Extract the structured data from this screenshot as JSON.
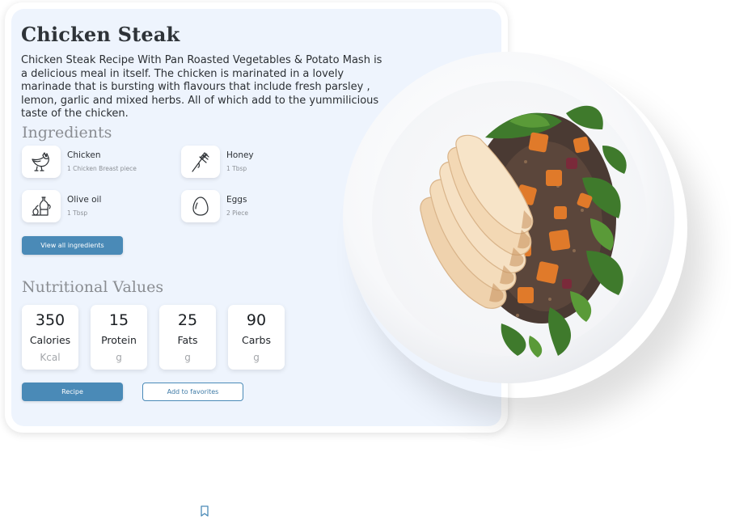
{
  "recipe": {
    "title": "Chicken Steak",
    "description": "Chicken Steak Recipe With Pan Roasted Vegetables & Potato Mash is a delicious meal in itself. The chicken is marinated in a lovely marinade that is bursting with flavours that include fresh parsley , lemon, garlic and mixed herbs. All of which add to the yummilicious taste of the chicken."
  },
  "ingredients": {
    "heading": "Ingredients",
    "items": [
      {
        "name": "Chicken",
        "qty": "1 Chicken Breast piece",
        "icon": "chicken-icon"
      },
      {
        "name": "Honey",
        "qty": "1 Tbsp",
        "icon": "honey-dipper-icon"
      },
      {
        "name": "Olive oil",
        "qty": "1 Tbsp",
        "icon": "olive-oil-icon"
      },
      {
        "name": "Eggs",
        "qty": "2 Piece",
        "icon": "egg-icon"
      }
    ],
    "view_all_label": "View all ingredients"
  },
  "nutrition": {
    "heading": "Nutritional Values",
    "items": [
      {
        "value": "350",
        "label": "Calories",
        "unit": "Kcal"
      },
      {
        "value": "15",
        "label": "Protein",
        "unit": "g"
      },
      {
        "value": "25",
        "label": "Fats",
        "unit": "g"
      },
      {
        "value": "90",
        "label": "Carbs",
        "unit": "g"
      }
    ]
  },
  "actions": {
    "recipe_label": "Recipe",
    "favorites_label": "Add to favorites"
  },
  "colors": {
    "accent": "#4a8ab7",
    "card_bg": "#eef4fd",
    "heading_gray": "#8a8d92"
  },
  "icons": {
    "bookmark": "bookmark-icon",
    "plate_photo": "chicken-salad-plate-image"
  }
}
